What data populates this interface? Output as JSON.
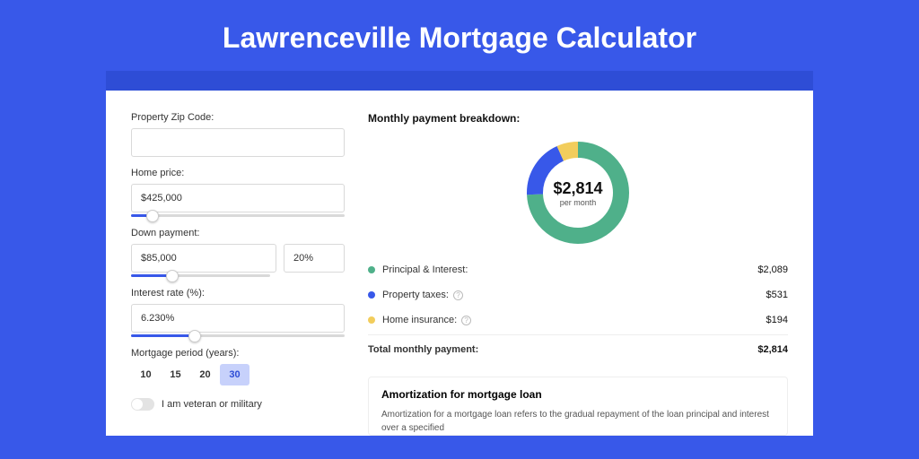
{
  "title": "Lawrenceville Mortgage Calculator",
  "form": {
    "zip": {
      "label": "Property Zip Code:",
      "value": ""
    },
    "home_price": {
      "label": "Home price:",
      "value": "$425,000",
      "slider_pct": 10
    },
    "down_payment": {
      "label": "Down payment:",
      "value": "$85,000",
      "pct": "20%",
      "slider_pct": 20
    },
    "interest": {
      "label": "Interest rate (%):",
      "value": "6.230%",
      "slider_pct": 30
    },
    "period": {
      "label": "Mortgage period (years):",
      "options": [
        "10",
        "15",
        "20",
        "30"
      ],
      "active": "30"
    },
    "veteran": {
      "label": "I am veteran or military"
    }
  },
  "breakdown": {
    "title": "Monthly payment breakdown:",
    "center_amount": "$2,814",
    "center_sub": "per month",
    "items": [
      {
        "label": "Principal & Interest:",
        "value": "$2,089",
        "color": "#4fb08a",
        "info": false
      },
      {
        "label": "Property taxes:",
        "value": "$531",
        "color": "#3858e9",
        "info": true
      },
      {
        "label": "Home insurance:",
        "value": "$194",
        "color": "#f2cd5c",
        "info": true
      }
    ],
    "total_label": "Total monthly payment:",
    "total_value": "$2,814"
  },
  "amortization": {
    "title": "Amortization for mortgage loan",
    "text": "Amortization for a mortgage loan refers to the gradual repayment of the loan principal and interest over a specified"
  },
  "chart_data": {
    "type": "pie",
    "title": "Monthly payment breakdown",
    "series": [
      {
        "name": "Principal & Interest",
        "value": 2089,
        "color": "#4fb08a"
      },
      {
        "name": "Property taxes",
        "value": 531,
        "color": "#3858e9"
      },
      {
        "name": "Home insurance",
        "value": 194,
        "color": "#f2cd5c"
      }
    ],
    "total": 2814
  }
}
